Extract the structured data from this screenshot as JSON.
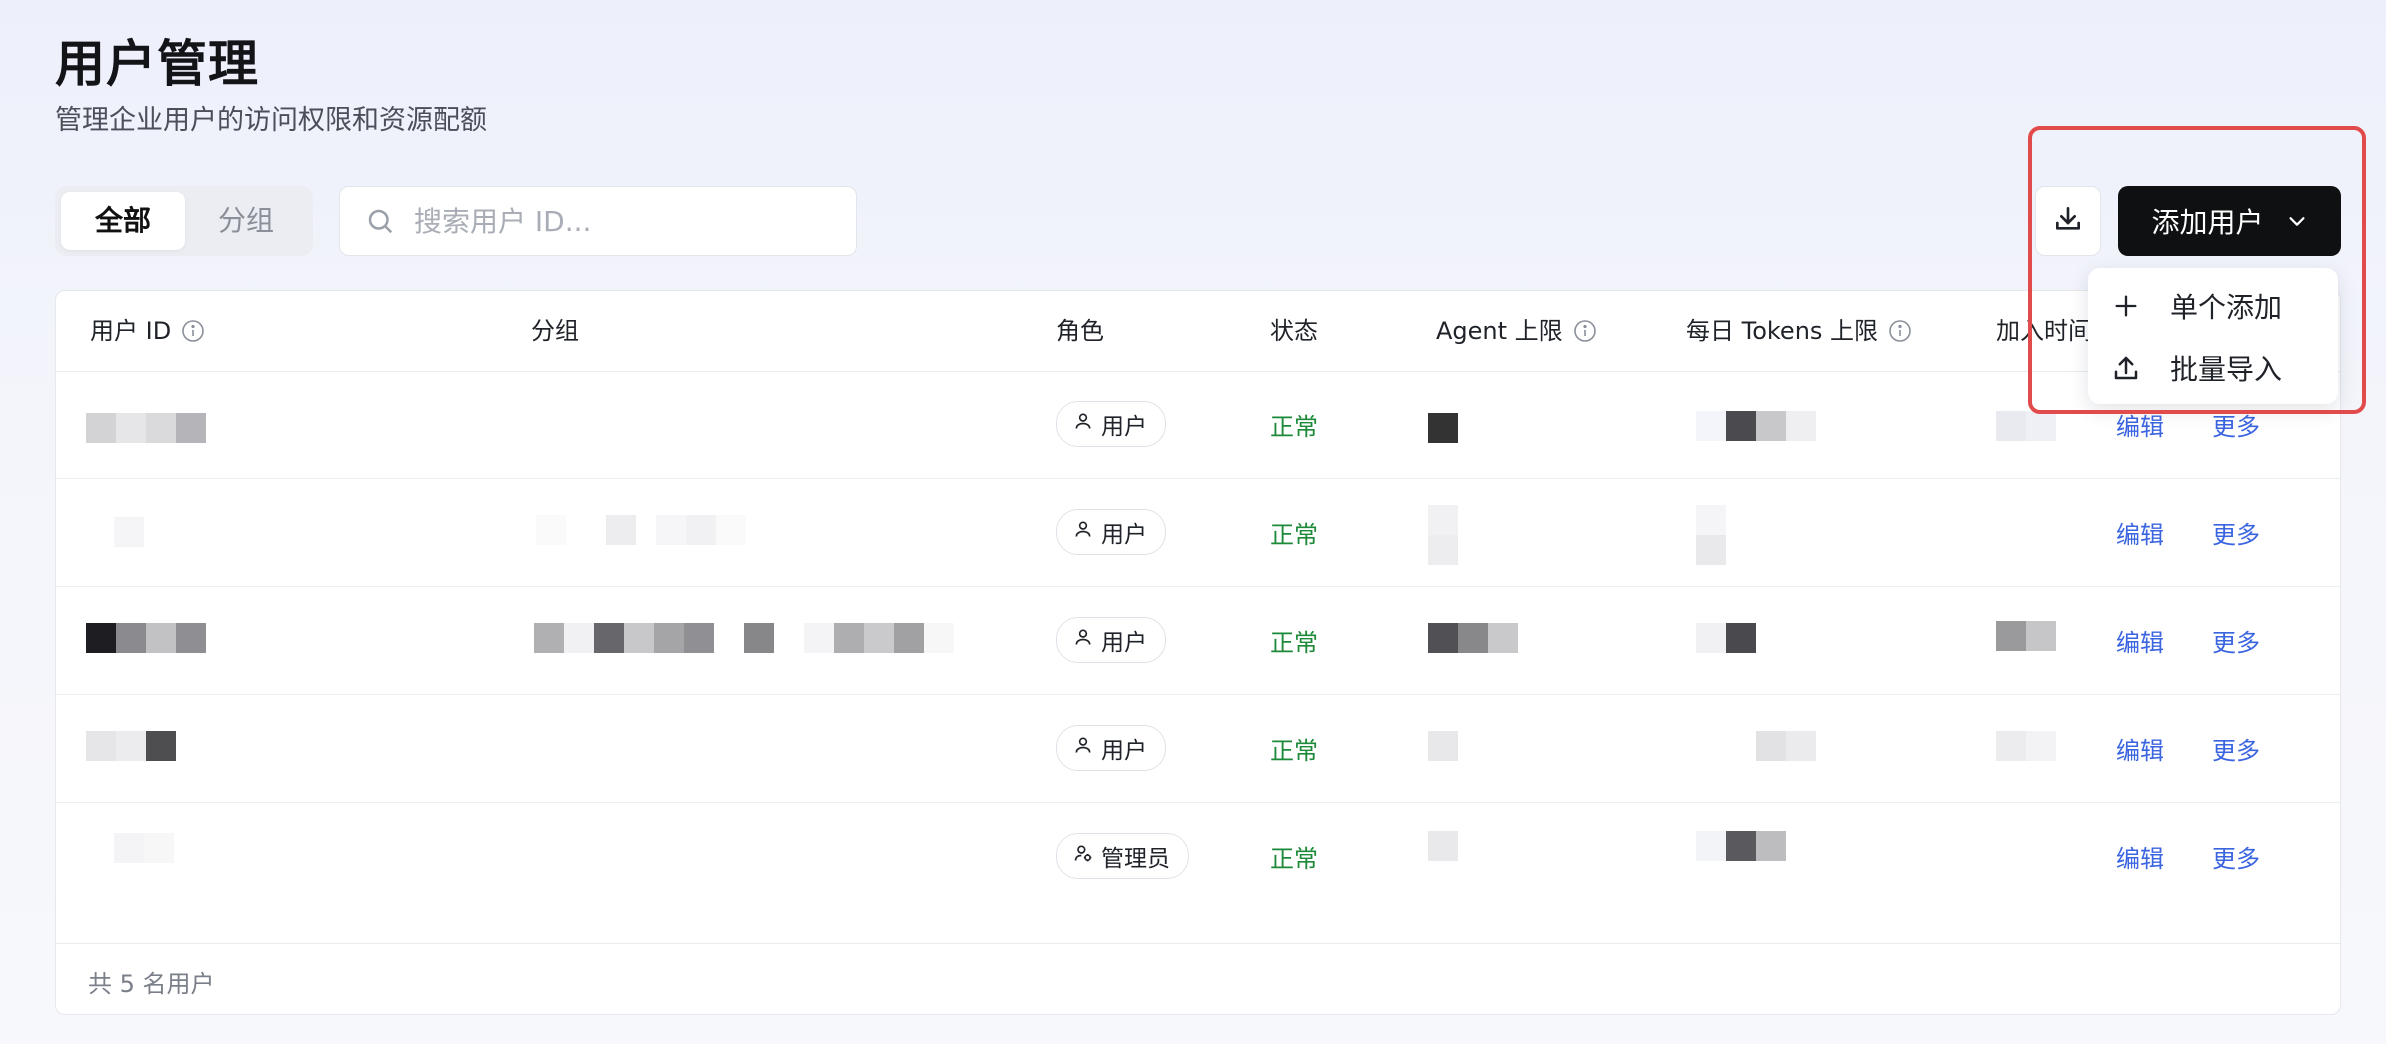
{
  "header": {
    "title": "用户管理",
    "subtitle": "管理企业用户的访问权限和资源配额"
  },
  "tabs": [
    {
      "label": "全部",
      "active": true
    },
    {
      "label": "分组",
      "active": false
    }
  ],
  "search": {
    "placeholder": "搜索用户 ID...",
    "icon": "search-icon"
  },
  "toolbar": {
    "download_icon": "download-icon",
    "add_label": "添加用户",
    "add_icon": "chevron-down-icon"
  },
  "menu": {
    "items": [
      {
        "label": "单个添加",
        "icon": "plus-icon"
      },
      {
        "label": "批量导入",
        "icon": "upload-icon"
      }
    ]
  },
  "table": {
    "columns": [
      "用户 ID",
      "分组",
      "角色",
      "状态",
      "Agent 上限",
      "每日 Tokens 上限",
      "加入时间"
    ],
    "rows": [
      {
        "role": "用户",
        "status": "正常",
        "edit": "编辑",
        "more": "更多"
      },
      {
        "role": "用户",
        "status": "正常",
        "edit": "编辑",
        "more": "更多"
      },
      {
        "role": "用户",
        "status": "正常",
        "edit": "编辑",
        "more": "更多"
      },
      {
        "role": "用户",
        "status": "正常",
        "edit": "编辑",
        "more": "更多"
      },
      {
        "role": "管理员",
        "status": "正常",
        "edit": "编辑",
        "more": "更多"
      }
    ]
  },
  "footer": {
    "summary": "共 5 名用户"
  },
  "colors": {
    "accent": "#3b64e0",
    "status_ok": "#1d8a3a",
    "primary_button": "#0f1012",
    "highlight": "#e24b4b"
  }
}
